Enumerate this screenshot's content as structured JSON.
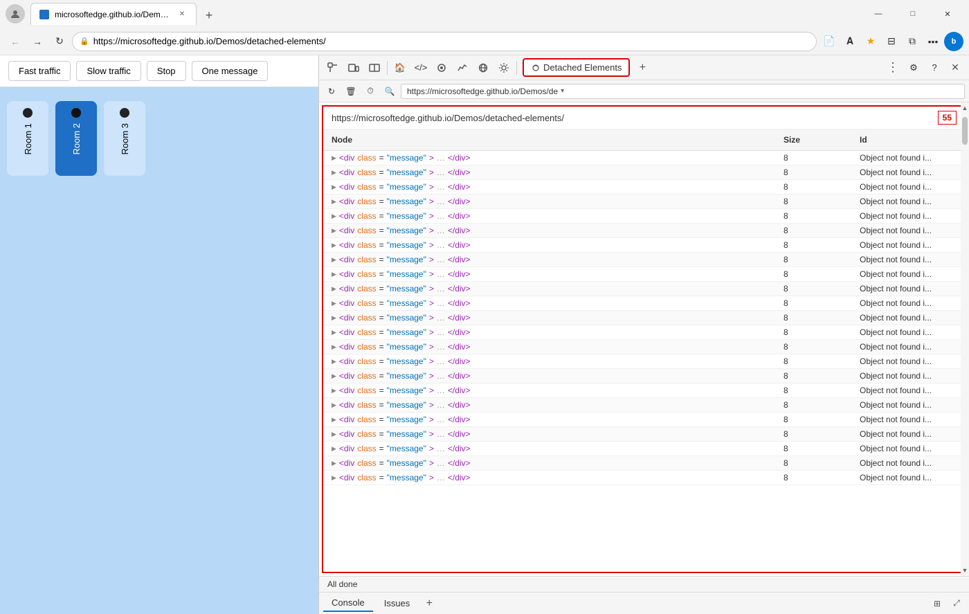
{
  "browser": {
    "tab_title": "microsoftedge.github.io/Demos/",
    "url": "https://microsoftedge.github.io/Demos/detached-elements/",
    "url_short": "https://microsoftedge.github.io/Demos/de ▾",
    "devtools_url": "https://microsoftedge.github.io/Demos/detached-elements/",
    "new_tab_label": "+",
    "minimize": "—",
    "maximize": "□",
    "close": "✕"
  },
  "demo_app": {
    "buttons": [
      "Fast traffic",
      "Slow traffic",
      "Stop",
      "One message"
    ],
    "rooms": [
      {
        "id": "room1",
        "label": "Room 1",
        "active": false
      },
      {
        "id": "room2",
        "label": "Room 2",
        "active": true
      },
      {
        "id": "room3",
        "label": "Room 3",
        "active": false
      }
    ]
  },
  "devtools": {
    "panel_title": "Detached Elements",
    "detached_url": "https://microsoftedge.github.io/Demos/detached-elements/",
    "count": "55",
    "status": "All done",
    "columns": {
      "node": "Node",
      "size": "Size",
      "id": "Id"
    },
    "rows": [
      {
        "node": "<div class=\"message\"> … </div>",
        "size": "8",
        "id": "Object not found i..."
      },
      {
        "node": "<div class=\"message\"> … </div>",
        "size": "8",
        "id": "Object not found i..."
      },
      {
        "node": "<div class=\"message\"> … </div>",
        "size": "8",
        "id": "Object not found i..."
      },
      {
        "node": "<div class=\"message\"> … </div>",
        "size": "8",
        "id": "Object not found i..."
      },
      {
        "node": "<div class=\"message\"> … </div>",
        "size": "8",
        "id": "Object not found i..."
      },
      {
        "node": "<div class=\"message\"> … </div>",
        "size": "8",
        "id": "Object not found i..."
      },
      {
        "node": "<div class=\"message\"> … </div>",
        "size": "8",
        "id": "Object not found i..."
      },
      {
        "node": "<div class=\"message\"> … </div>",
        "size": "8",
        "id": "Object not found i..."
      },
      {
        "node": "<div class=\"message\"> … </div>",
        "size": "8",
        "id": "Object not found i..."
      },
      {
        "node": "<div class=\"message\"> … </div>",
        "size": "8",
        "id": "Object not found i..."
      },
      {
        "node": "<div class=\"message\"> … </div>",
        "size": "8",
        "id": "Object not found i..."
      },
      {
        "node": "<div class=\"message\"> … </div>",
        "size": "8",
        "id": "Object not found i..."
      },
      {
        "node": "<div class=\"message\"> … </div>",
        "size": "8",
        "id": "Object not found i..."
      },
      {
        "node": "<div class=\"message\"> … </div>",
        "size": "8",
        "id": "Object not found i..."
      },
      {
        "node": "<div class=\"message\"> … </div>",
        "size": "8",
        "id": "Object not found i..."
      },
      {
        "node": "<div class=\"message\"> … </div>",
        "size": "8",
        "id": "Object not found i..."
      },
      {
        "node": "<div class=\"message\"> … </div>",
        "size": "8",
        "id": "Object not found i..."
      },
      {
        "node": "<div class=\"message\"> … </div>",
        "size": "8",
        "id": "Object not found i..."
      },
      {
        "node": "<div class=\"message\"> … </div>",
        "size": "8",
        "id": "Object not found i..."
      },
      {
        "node": "<div class=\"message\"> … </div>",
        "size": "8",
        "id": "Object not found i..."
      },
      {
        "node": "<div class=\"message\"> … </div>",
        "size": "8",
        "id": "Object not found i..."
      },
      {
        "node": "<div class=\"message\"> … </div>",
        "size": "8",
        "id": "Object not found i..."
      },
      {
        "node": "<div class=\"message\"> … </div>",
        "size": "8",
        "id": "Object not found i..."
      }
    ],
    "bottom_tabs": [
      "Console",
      "Issues"
    ],
    "toolbar_icons": [
      "inspect",
      "device-toggle",
      "toggle-split",
      "home",
      "elements",
      "recorder",
      "performance-monitor",
      "network",
      "settings-extra",
      "detached-elements"
    ],
    "nav_icons": [
      "refresh",
      "trash",
      "history",
      "search"
    ]
  },
  "colors": {
    "accent_red": "#d00000",
    "accent_blue": "#1e6fc5",
    "room2_active": "#1e6fc5",
    "node_purple": "#9c27b0",
    "attr_orange": "#e06c1a",
    "val_blue": "#0070b8"
  }
}
